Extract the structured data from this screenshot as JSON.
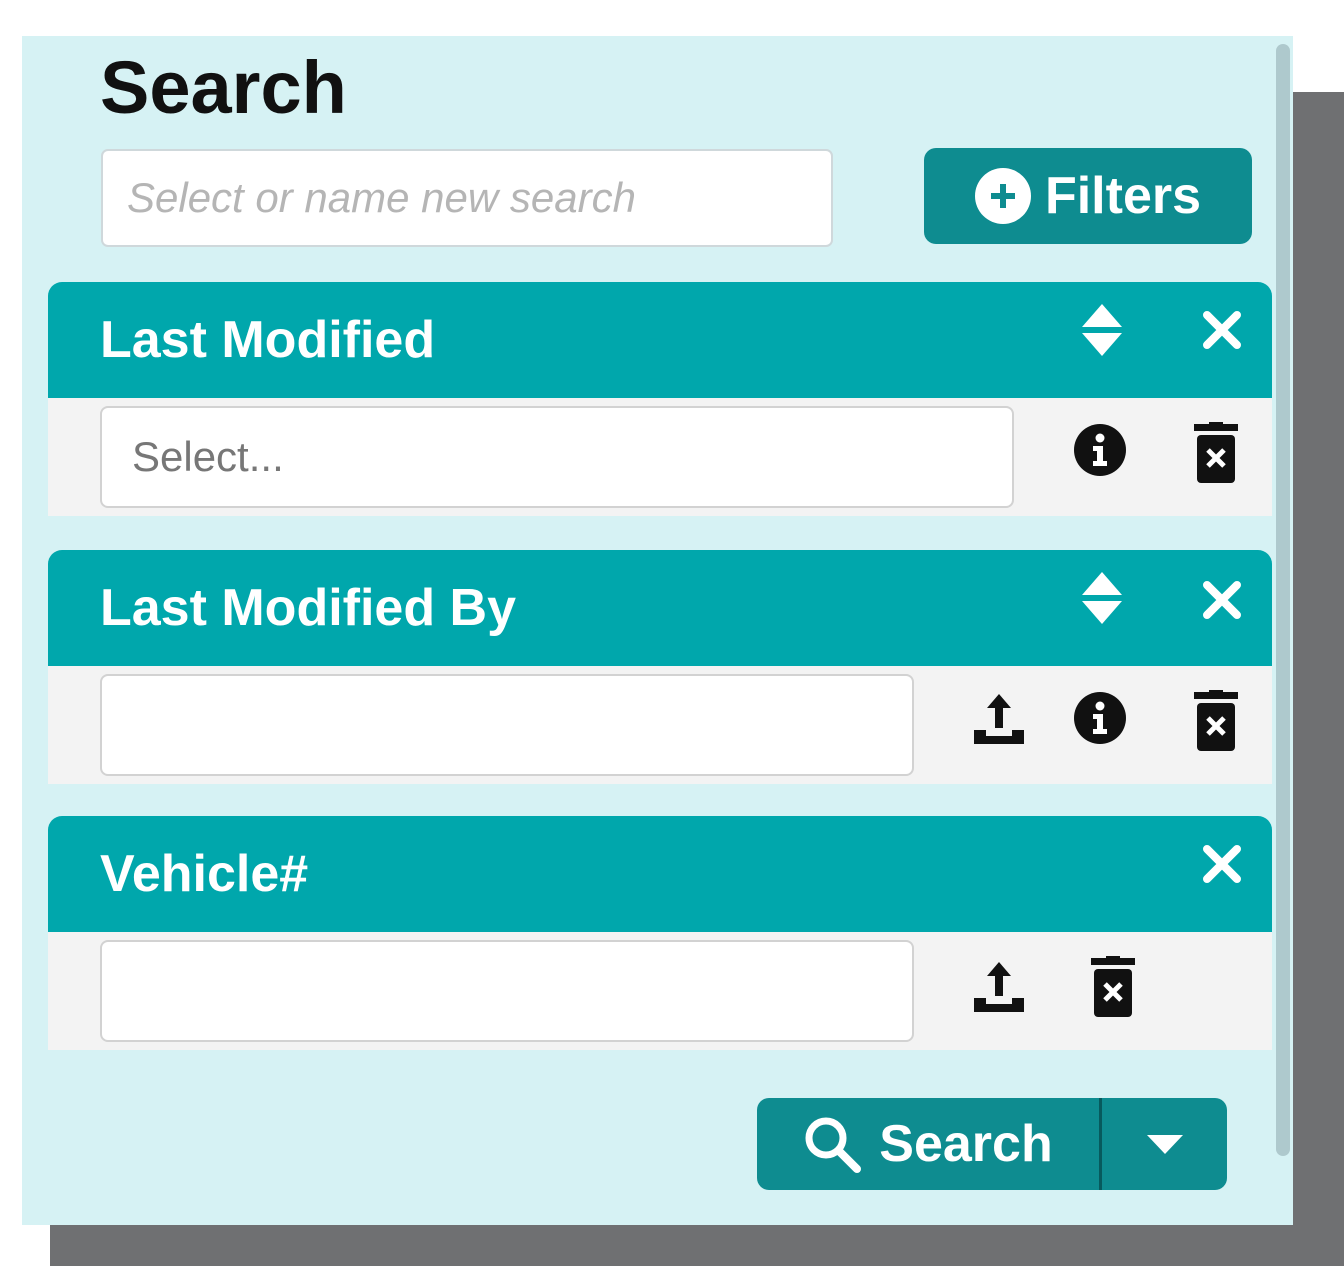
{
  "panel": {
    "title": "Search",
    "search_name_placeholder": "Select or name new search",
    "filters_label": "Filters"
  },
  "sections": [
    {
      "label": "Last Modified",
      "field_placeholder": "Select...",
      "icons": [
        "sort-icon",
        "close-icon",
        "info-icon",
        "delete-icon"
      ]
    },
    {
      "label": "Last Modified By",
      "field_placeholder": "",
      "icons": [
        "sort-icon",
        "close-icon",
        "upload-icon",
        "info-icon",
        "delete-icon"
      ]
    },
    {
      "label": "Vehicle#",
      "field_placeholder": "",
      "icons": [
        "close-icon",
        "upload-icon",
        "delete-icon"
      ]
    }
  ],
  "actions": {
    "search_label": "Search"
  },
  "colors": {
    "panel_bg": "#d6f2f4",
    "section_header": "#00a7ac",
    "button": "#0e8c90",
    "section_body": "#f3f3f3"
  }
}
